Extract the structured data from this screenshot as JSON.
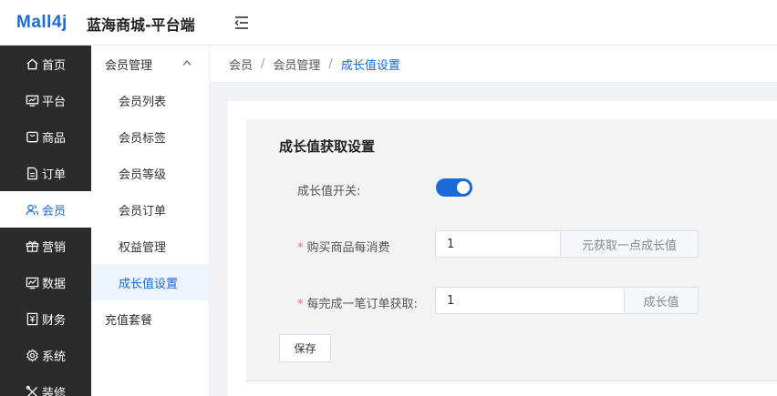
{
  "header": {
    "logo_text": "Mall4j",
    "app_title": "蓝海商城-平台端"
  },
  "nav1": {
    "items": [
      {
        "label": "首页",
        "icon": "home-icon"
      },
      {
        "label": "平台",
        "icon": "monitor-icon"
      },
      {
        "label": "商品",
        "icon": "bag-icon"
      },
      {
        "label": "订单",
        "icon": "document-icon"
      },
      {
        "label": "会员",
        "icon": "users-icon",
        "active": true
      },
      {
        "label": "营销",
        "icon": "gift-icon"
      },
      {
        "label": "数据",
        "icon": "chart-icon"
      },
      {
        "label": "财务",
        "icon": "finance-icon"
      },
      {
        "label": "系统",
        "icon": "gear-icon"
      },
      {
        "label": "装修",
        "icon": "tools-icon"
      }
    ]
  },
  "nav2": {
    "group_label": "会员管理",
    "items": [
      {
        "label": "会员列表"
      },
      {
        "label": "会员标签"
      },
      {
        "label": "会员等级"
      },
      {
        "label": "会员订单"
      },
      {
        "label": "权益管理"
      },
      {
        "label": "成长值设置",
        "active": true
      }
    ],
    "extra_label": "充值套餐"
  },
  "breadcrumb": {
    "items": [
      "会员",
      "会员管理",
      "成长值设置"
    ],
    "separator": "/"
  },
  "form": {
    "title": "成长值获取设置",
    "switch_label": "成长值开关:",
    "switch_on": true,
    "purchase": {
      "required_mark": "*",
      "label": "购买商品每消费",
      "value": "1",
      "suffix": "元获取一点成长值"
    },
    "order": {
      "required_mark": "*",
      "label": "每完成一笔订单获取:",
      "value": "1",
      "suffix": "成长值"
    },
    "save_label": "保存"
  },
  "colors": {
    "primary": "#1a6ad8",
    "sidebar_dark": "#2b2b2b",
    "required": "#f56c6c"
  }
}
